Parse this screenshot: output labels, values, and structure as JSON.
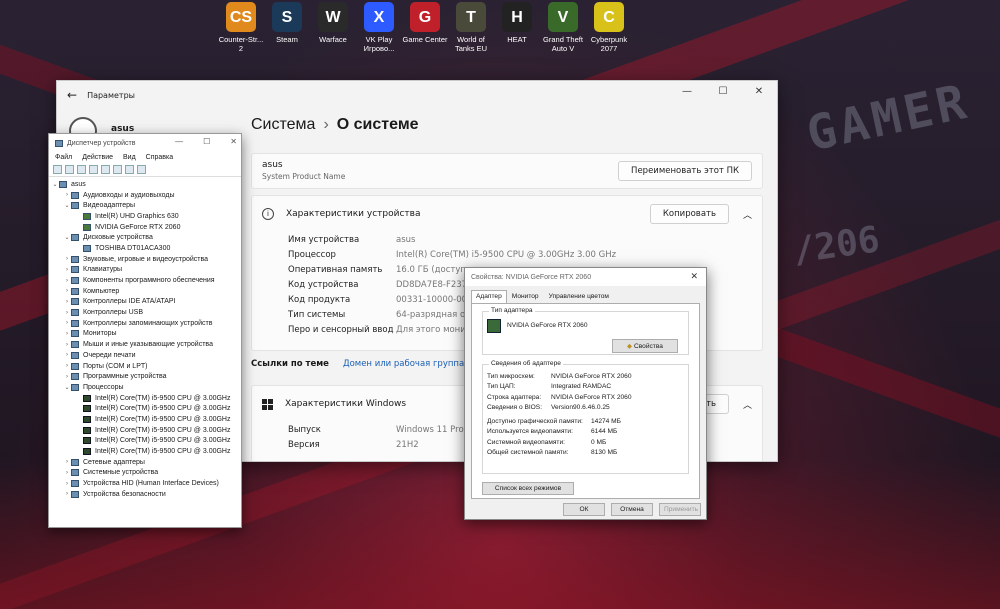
{
  "desktop": {
    "icons": [
      {
        "label": "Counter-Str... 2",
        "icon": "cs2-icon",
        "color": "#e08a1e",
        "glyph": "CS"
      },
      {
        "label": "Steam",
        "icon": "steam-icon",
        "color": "#1b3a5a",
        "glyph": "S"
      },
      {
        "label": "Warface",
        "icon": "warface-icon",
        "color": "#2a2a2a",
        "glyph": "W"
      },
      {
        "label": "VK Play Игрово...",
        "icon": "vkplay-icon",
        "color": "#2d5bff",
        "glyph": "X"
      },
      {
        "label": "Game Center",
        "icon": "gamecenter-icon",
        "color": "#c0202a",
        "glyph": "G"
      },
      {
        "label": "World of Tanks EU",
        "icon": "wot-icon",
        "color": "#4a4a3a",
        "glyph": "T"
      },
      {
        "label": "HEAT",
        "icon": "heat-icon",
        "color": "#222222",
        "glyph": "H"
      },
      {
        "label": "Grand Theft Auto V",
        "icon": "gta-icon",
        "color": "#3a6a2a",
        "glyph": "V"
      },
      {
        "label": "Cyberpunk 2077",
        "icon": "cyberpunk-icon",
        "color": "#d8c21a",
        "glyph": "C"
      }
    ],
    "wallpaper_text_1": "GAMER",
    "wallpaper_text_2": "/206"
  },
  "settings": {
    "window_title": "Параметры",
    "user": "asus",
    "breadcrumb_parent": "Система",
    "breadcrumb_current": "О системе",
    "device_name": "asus",
    "product_name": "System Product Name",
    "rename_button": "Переименовать этот ПК",
    "device_specs_title": "Характеристики устройства",
    "copy_button": "Копировать",
    "specs": [
      {
        "key": "Имя устройства",
        "value": "asus"
      },
      {
        "key": "Процессор",
        "value": "Intel(R) Core(TM) i5-9500 CPU @ 3.00GHz   3.00 GHz"
      },
      {
        "key": "Оперативная память",
        "value": "16.0 ГБ (доступно:"
      },
      {
        "key": "Код устройства",
        "value": "DD8DA7E8-F237-4"
      },
      {
        "key": "Код продукта",
        "value": "00331-10000-00001"
      },
      {
        "key": "Тип системы",
        "value": "64-разрядная опе"
      },
      {
        "key": "Перо и сенсорный ввод",
        "value": "Для этого монито"
      }
    ],
    "related_label": "Ссылки по теме",
    "related_links": [
      "Домен или рабочая группа",
      "За"
    ],
    "windows_specs_title": "Характеристики Windows",
    "copy_button_2": "ровать",
    "win_specs": [
      {
        "key": "Выпуск",
        "value": "Windows 11 Pro"
      },
      {
        "key": "Версия",
        "value": "21H2"
      }
    ]
  },
  "device_manager": {
    "title": "Диспетчер устройств",
    "menu": [
      "Файл",
      "Действие",
      "Вид",
      "Справка"
    ],
    "tree": [
      {
        "label": "asus",
        "level": 0,
        "exp": "⌄"
      },
      {
        "label": "Аудиовходы и аудиовыходы",
        "level": 1,
        "exp": "›"
      },
      {
        "label": "Видеоадаптеры",
        "level": 1,
        "exp": "⌄"
      },
      {
        "label": "Intel(R) UHD Graphics 630",
        "level": 2,
        "exp": "",
        "kind": "gpu"
      },
      {
        "label": "NVIDIA GeForce RTX 2060",
        "level": 2,
        "exp": "",
        "kind": "gpu"
      },
      {
        "label": "Дисковые устройства",
        "level": 1,
        "exp": "⌄"
      },
      {
        "label": "TOSHIBA DT01ACA300",
        "level": 2,
        "exp": ""
      },
      {
        "label": "Звуковые, игровые и видеоустройства",
        "level": 1,
        "exp": "›"
      },
      {
        "label": "Клавиатуры",
        "level": 1,
        "exp": "›"
      },
      {
        "label": "Компоненты программного обеспечения",
        "level": 1,
        "exp": "›"
      },
      {
        "label": "Компьютер",
        "level": 1,
        "exp": "›"
      },
      {
        "label": "Контроллеры IDE ATA/ATAPI",
        "level": 1,
        "exp": "›"
      },
      {
        "label": "Контроллеры USB",
        "level": 1,
        "exp": "›"
      },
      {
        "label": "Контроллеры запоминающих устройств",
        "level": 1,
        "exp": "›"
      },
      {
        "label": "Мониторы",
        "level": 1,
        "exp": "›"
      },
      {
        "label": "Мыши и иные указывающие устройства",
        "level": 1,
        "exp": "›"
      },
      {
        "label": "Очереди печати",
        "level": 1,
        "exp": "›"
      },
      {
        "label": "Порты (COM и LPT)",
        "level": 1,
        "exp": "›"
      },
      {
        "label": "Программные устройства",
        "level": 1,
        "exp": "›"
      },
      {
        "label": "Процессоры",
        "level": 1,
        "exp": "⌄"
      },
      {
        "label": "Intel(R) Core(TM) i5-9500 CPU @ 3.00GHz",
        "level": 2,
        "exp": "",
        "kind": "cpu"
      },
      {
        "label": "Intel(R) Core(TM) i5-9500 CPU @ 3.00GHz",
        "level": 2,
        "exp": "",
        "kind": "cpu"
      },
      {
        "label": "Intel(R) Core(TM) i5-9500 CPU @ 3.00GHz",
        "level": 2,
        "exp": "",
        "kind": "cpu"
      },
      {
        "label": "Intel(R) Core(TM) i5-9500 CPU @ 3.00GHz",
        "level": 2,
        "exp": "",
        "kind": "cpu"
      },
      {
        "label": "Intel(R) Core(TM) i5-9500 CPU @ 3.00GHz",
        "level": 2,
        "exp": "",
        "kind": "cpu"
      },
      {
        "label": "Intel(R) Core(TM) i5-9500 CPU @ 3.00GHz",
        "level": 2,
        "exp": "",
        "kind": "cpu"
      },
      {
        "label": "Сетевые адаптеры",
        "level": 1,
        "exp": "›"
      },
      {
        "label": "Системные устройства",
        "level": 1,
        "exp": "›"
      },
      {
        "label": "Устройства HID (Human Interface Devices)",
        "level": 1,
        "exp": "›"
      },
      {
        "label": "Устройства безопасности",
        "level": 1,
        "exp": "›"
      }
    ]
  },
  "gpu_props": {
    "title": "Свойства: NVIDIA GeForce RTX 2060",
    "tabs": [
      "Адаптер",
      "Монитор",
      "Управление цветом"
    ],
    "adapter_type_label": "Тип адаптера",
    "adapter_name": "NVIDIA GeForce RTX 2060",
    "properties_button": "Свойства",
    "info_label": "Сведения об адаптере",
    "info": [
      {
        "key": "Тип микросхем:",
        "value": "NVIDIA GeForce RTX 2060"
      },
      {
        "key": "Тип ЦАП:",
        "value": "Integrated RAMDAC"
      },
      {
        "key": "Строка адаптера:",
        "value": "NVIDIA GeForce RTX 2060"
      },
      {
        "key": "Сведения о BIOS:",
        "value": "Version90.6.46.0.25"
      }
    ],
    "memory": [
      {
        "key": "Доступно графической памяти:",
        "value": "14274 МБ"
      },
      {
        "key": "Используется видеопамяти:",
        "value": "6144 МБ"
      },
      {
        "key": "Системной видеопамяти:",
        "value": "0 МБ"
      },
      {
        "key": "Общей системной памяти:",
        "value": "8130 МБ"
      }
    ],
    "list_modes_button": "Список всех режимов",
    "ok_button": "ОК",
    "cancel_button": "Отмена",
    "apply_button": "Применить"
  }
}
